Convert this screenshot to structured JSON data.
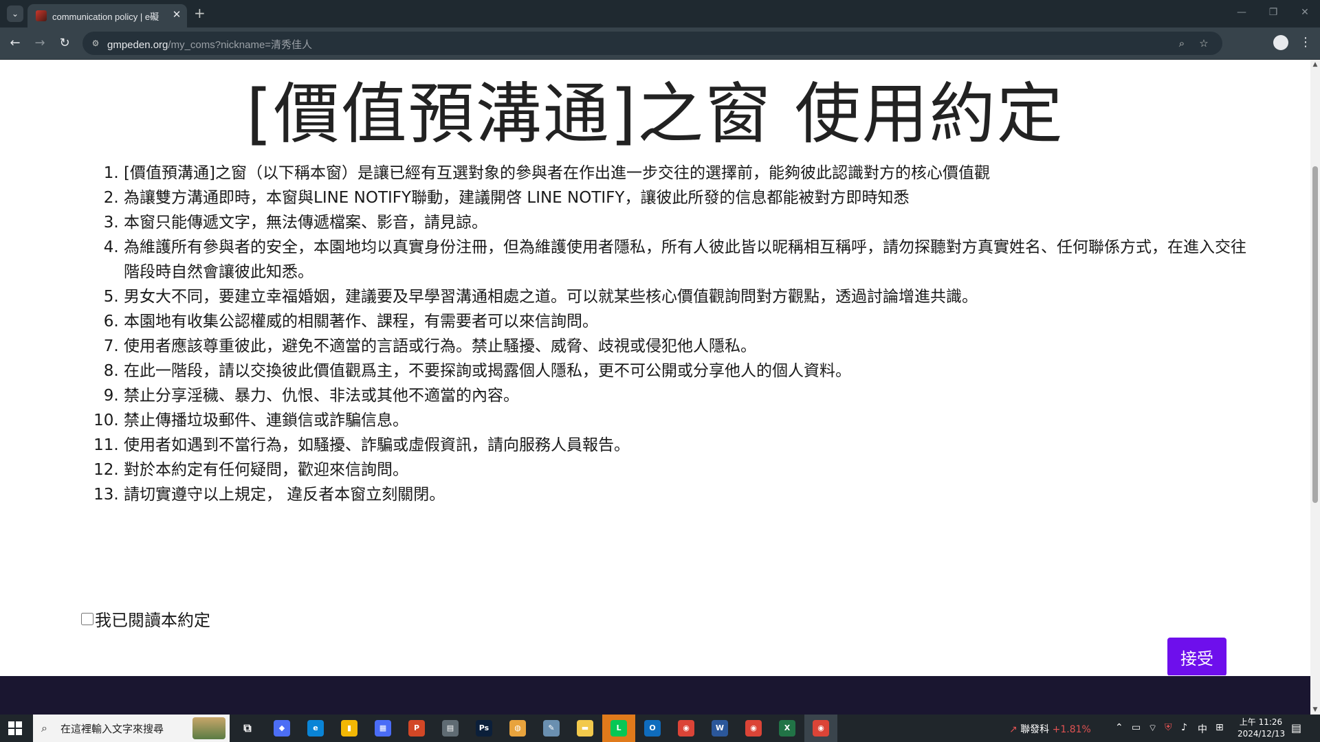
{
  "browser": {
    "tab": {
      "title": "communication policy | e礙"
    },
    "address": {
      "host": "gmpeden.org",
      "path": "/my_coms?nickname=清秀佳人"
    }
  },
  "page": {
    "title": "[價值預溝通]之窗 使用約定",
    "rules": [
      "[價值預溝通]之窗（以下稱本窗）是讓已經有互選對象的參與者在作出進一步交往的選擇前，能夠彼此認識對方的核心價值觀",
      "為讓雙方溝通即時，本窗與LINE NOTIFY聯動，建議開啓 LINE NOTIFY，讓彼此所發的信息都能被對方即時知悉",
      "本窗只能傳遞文字，無法傳遞檔案、影音，請見諒。",
      "為維護所有參與者的安全，本園地均以真實身份注冊，但為維護使用者隱私，所有人彼此皆以昵稱相互稱呼，請勿探聽對方真實姓名、任何聯係方式，在進入交往階段時自然會讓彼此知悉。",
      "男女大不同，要建立幸福婚姻，建議要及早學習溝通相處之道。可以就某些核心價值觀詢問對方觀點，透過討論增進共識。",
      "本園地有收集公認權威的相關著作、課程，有需要者可以來信詢問。",
      "使用者應該尊重彼此，避免不適當的言語或行為。禁止騷擾、威脅、歧視或侵犯他人隱私。",
      "在此一階段，請以交換彼此價值觀爲主，不要探詢或揭露個人隱私，更不可公開或分享他人的個人資料。",
      "禁止分享淫穢、暴力、仇恨、非法或其他不適當的內容。",
      "禁止傳播垃圾郵件、連鎖信或詐騙信息。",
      "使用者如遇到不當行為，如騷擾、詐騙或虛假資訊，請向服務人員報告。",
      "對於本約定有任何疑問，歡迎來信詢問。",
      "請切實遵守以上規定， 違反者本窗立刻關閉。"
    ],
    "agree_label": "我已閱讀本約定",
    "agree_checked": false,
    "accept_button": "接受",
    "accept_color": "#6e0fec"
  },
  "taskbar": {
    "search_placeholder": "在這裡輸入文字來搜尋",
    "apps": [
      "copilot-icon",
      "edge-icon",
      "file-icon",
      "store-icon",
      "powerpoint-icon",
      "calculator-icon",
      "photoshop-icon",
      "paint-icon",
      "edit-icon",
      "folder-icon",
      "line-icon",
      "outlook-icon",
      "chrome-icon",
      "word-icon",
      "chrome-icon",
      "excel-icon",
      "chrome-active-icon"
    ],
    "stock_name": "聯發科",
    "stock_change": "+1.81%",
    "ime": "中",
    "time": "上午 11:26",
    "date": "2024/12/13"
  }
}
